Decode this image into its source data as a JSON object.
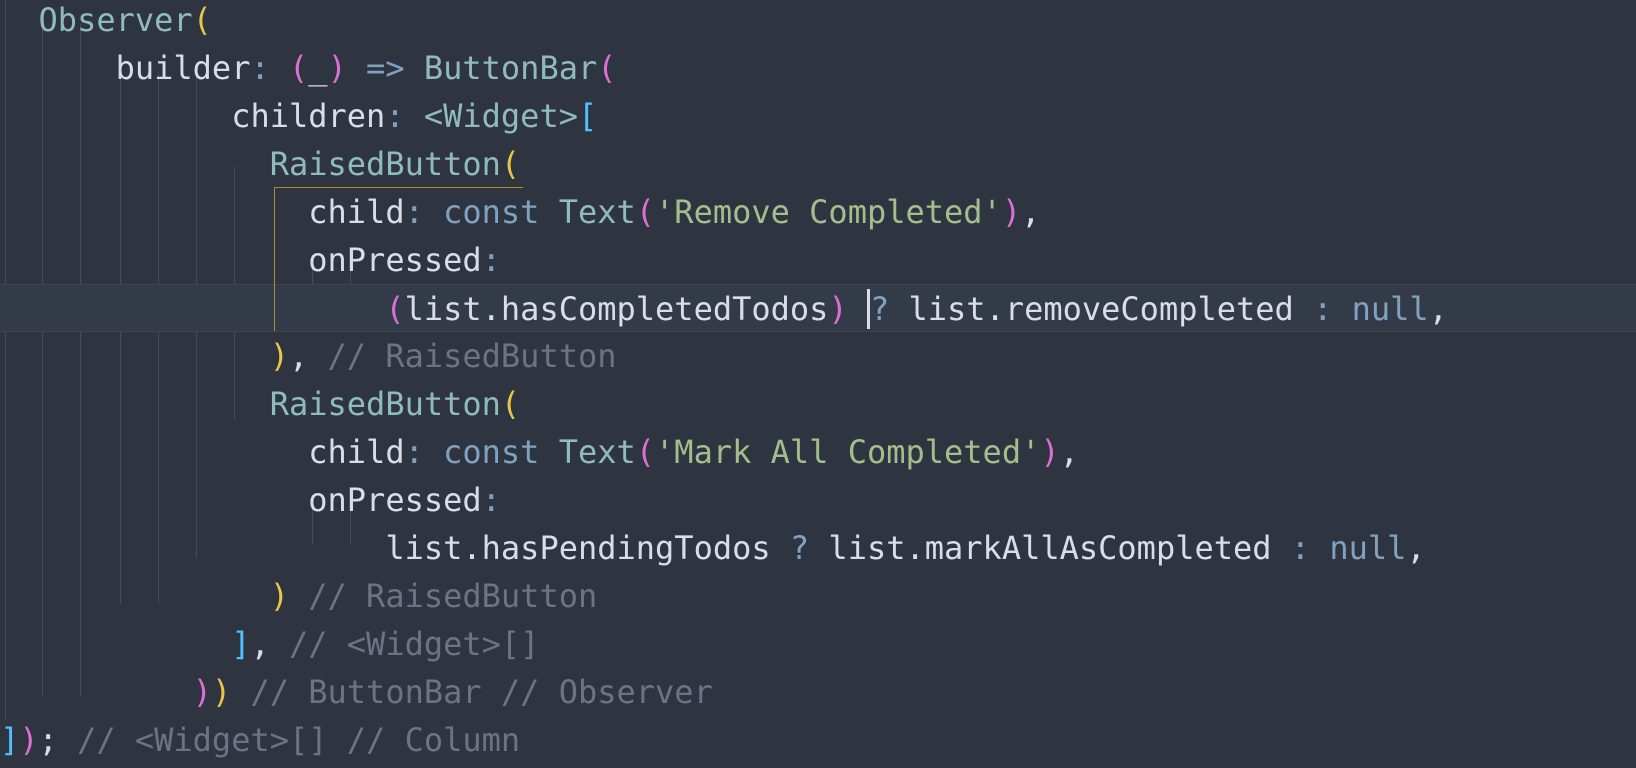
{
  "editor": {
    "colors": {
      "background": "#2e3440",
      "current_line": "#343b48",
      "text": "#d8dee9",
      "class": "#8fbcbb",
      "keyword": "#81a1c1",
      "string": "#a3be8c",
      "comment": "#6b7385",
      "bracket_level_1": "#e8c547",
      "bracket_level_2": "#da70d6",
      "bracket_level_3": "#4fc1ff"
    },
    "lines": [
      {
        "tokens": [
          [
            "plain",
            "  "
          ],
          [
            "class",
            "Observer"
          ],
          [
            "b1",
            "("
          ]
        ]
      },
      {
        "tokens": [
          [
            "plain",
            "      builder"
          ],
          [
            "punct",
            ": "
          ],
          [
            "b2",
            "("
          ],
          [
            "plain",
            "_"
          ],
          [
            "b2",
            ")"
          ],
          [
            "punct",
            " => "
          ],
          [
            "class",
            "ButtonBar"
          ],
          [
            "b2",
            "("
          ]
        ]
      },
      {
        "tokens": [
          [
            "plain",
            "            children"
          ],
          [
            "punct",
            ": "
          ],
          [
            "class",
            "<Widget>"
          ],
          [
            "b3",
            "["
          ]
        ]
      },
      {
        "tokens": [
          [
            "plain",
            "              "
          ],
          [
            "class",
            "RaisedButton"
          ],
          [
            "b1",
            "("
          ]
        ]
      },
      {
        "tokens": [
          [
            "plain",
            "                child"
          ],
          [
            "punct",
            ": "
          ],
          [
            "keyword",
            "const "
          ],
          [
            "class",
            "Text"
          ],
          [
            "b2",
            "("
          ],
          [
            "string",
            "'Remove Completed'"
          ],
          [
            "b2",
            ")"
          ],
          [
            "plain",
            ","
          ]
        ]
      },
      {
        "tokens": [
          [
            "plain",
            "                onPressed"
          ],
          [
            "punct",
            ":"
          ]
        ]
      },
      {
        "tokens": [
          [
            "plain",
            "                    "
          ],
          [
            "b2",
            "("
          ],
          [
            "plain",
            "list.hasCompletedTodos"
          ],
          [
            "b2",
            ")"
          ],
          [
            "plain",
            " "
          ],
          [
            "cursor",
            ""
          ],
          [
            "punct",
            "? "
          ],
          [
            "plain",
            "list.removeCompleted "
          ],
          [
            "punct",
            ": "
          ],
          [
            "keyword",
            "null"
          ],
          [
            "plain",
            ","
          ]
        ]
      },
      {
        "tokens": [
          [
            "plain",
            "              "
          ],
          [
            "b1",
            ")"
          ],
          [
            "plain",
            ", "
          ],
          [
            "comment",
            "// RaisedButton"
          ]
        ]
      },
      {
        "tokens": [
          [
            "plain",
            "              "
          ],
          [
            "class",
            "RaisedButton"
          ],
          [
            "b1",
            "("
          ]
        ]
      },
      {
        "tokens": [
          [
            "plain",
            "                child"
          ],
          [
            "punct",
            ": "
          ],
          [
            "keyword",
            "const "
          ],
          [
            "class",
            "Text"
          ],
          [
            "b2",
            "("
          ],
          [
            "string",
            "'Mark All Completed'"
          ],
          [
            "b2",
            ")"
          ],
          [
            "plain",
            ","
          ]
        ]
      },
      {
        "tokens": [
          [
            "plain",
            "                onPressed"
          ],
          [
            "punct",
            ":"
          ]
        ]
      },
      {
        "tokens": [
          [
            "plain",
            "                    list.hasPendingTodos "
          ],
          [
            "punct",
            "? "
          ],
          [
            "plain",
            "list.markAllAsCompleted "
          ],
          [
            "punct",
            ": "
          ],
          [
            "keyword",
            "null"
          ],
          [
            "plain",
            ","
          ]
        ]
      },
      {
        "tokens": [
          [
            "plain",
            "              "
          ],
          [
            "b1",
            ")"
          ],
          [
            "plain",
            " "
          ],
          [
            "comment",
            "// RaisedButton"
          ]
        ]
      },
      {
        "tokens": [
          [
            "plain",
            "            "
          ],
          [
            "b3",
            "]"
          ],
          [
            "plain",
            ", "
          ],
          [
            "comment",
            "// <Widget>[]"
          ]
        ]
      },
      {
        "tokens": [
          [
            "plain",
            "          "
          ],
          [
            "b2",
            ")"
          ],
          [
            "b1",
            ")"
          ],
          [
            "plain",
            " "
          ],
          [
            "comment",
            "// ButtonBar // Observer"
          ]
        ]
      },
      {
        "tokens": [
          [
            "b3",
            "]"
          ],
          [
            "b2",
            ")"
          ],
          [
            "plain",
            "; "
          ],
          [
            "comment",
            "// <Widget>[] // Column"
          ]
        ]
      }
    ]
  }
}
